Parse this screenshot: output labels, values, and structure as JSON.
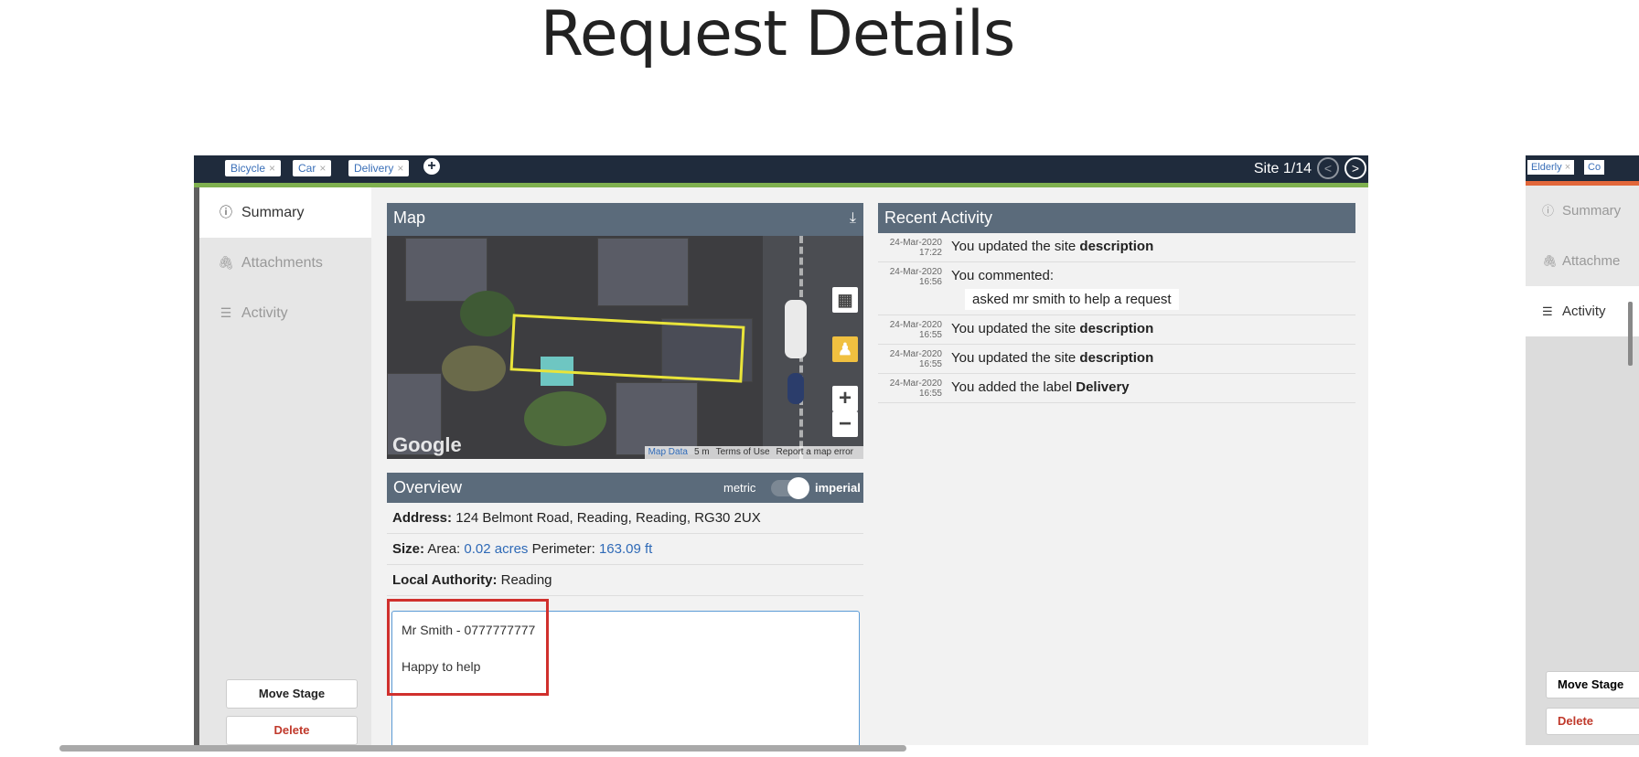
{
  "page_title": "Request Details",
  "main_panel": {
    "tags": [
      {
        "label": "Bicycle"
      },
      {
        "label": "Car"
      },
      {
        "label": "Delivery"
      }
    ],
    "tag_remove_glyph": "×",
    "add_tag_icon": "plus-circle-icon",
    "site_counter": "Site 1/14",
    "nav": {
      "prev": "<",
      "next": ">"
    },
    "sidebar": {
      "items": [
        {
          "label": "Summary",
          "icon": "info-icon"
        },
        {
          "label": "Attachments",
          "icon": "paperclip-icon"
        },
        {
          "label": "Activity",
          "icon": "list-icon"
        }
      ],
      "move_stage": "Move Stage",
      "delete": "Delete"
    },
    "map": {
      "title": "Map",
      "download_icon": "download-icon",
      "google": "Google",
      "footer": {
        "map_data": "Map Data",
        "scale": "5 m",
        "terms": "Terms of Use",
        "report": "Report a map error"
      },
      "controls": {
        "zoom_in": "+",
        "zoom_out": "−"
      }
    },
    "overview": {
      "title": "Overview",
      "toggle_metric": "metric",
      "toggle_imperial": "imperial",
      "address_label": "Address:",
      "address": "124 Belmont Road, Reading, Reading, RG30 2UX",
      "size_label": "Size:",
      "area_label": "Area:",
      "area_value": "0.02 acres",
      "perimeter_label": "Perimeter:",
      "perimeter_value": "163.09 ft",
      "authority_label": "Local Authority:",
      "authority": "Reading",
      "description_lines": [
        "Mr Smith - 0777777777",
        "Happy to help"
      ]
    },
    "activity": {
      "title": "Recent Activity",
      "items": [
        {
          "date": "24-Mar-2020",
          "time": "17:22",
          "text": "You updated the site ",
          "bold": "description"
        },
        {
          "date": "24-Mar-2020",
          "time": "16:56",
          "text": "You commented:",
          "bold": "",
          "comment": "asked mr smith to help a request"
        },
        {
          "date": "24-Mar-2020",
          "time": "16:55",
          "text": "You updated the site ",
          "bold": "description"
        },
        {
          "date": "24-Mar-2020",
          "time": "16:55",
          "text": "You updated the site ",
          "bold": "description"
        },
        {
          "date": "24-Mar-2020",
          "time": "16:55",
          "text": "You added the label ",
          "bold": "Delivery"
        }
      ]
    }
  },
  "secondary_panel": {
    "tags": [
      {
        "label": "Elderly"
      },
      {
        "label": "Co"
      }
    ],
    "sidebar": {
      "items": [
        {
          "label": "Summary"
        },
        {
          "label": "Attachme"
        },
        {
          "label": "Activity"
        }
      ],
      "move_stage": "Move Stage",
      "delete": "Delete"
    }
  },
  "colors": {
    "header": "#1f2b3c",
    "accent_green": "#7fb04f",
    "accent_orange": "#e2673a",
    "highlight_red": "#d0302d",
    "link_blue": "#2f6ab7"
  }
}
